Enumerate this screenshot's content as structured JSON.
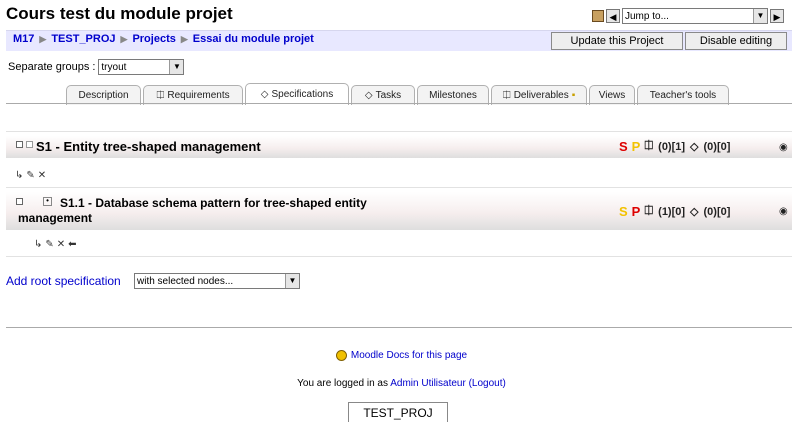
{
  "header": {
    "title": "Cours test du module projet",
    "jump_to": "Jump to..."
  },
  "breadcrumb": [
    "M17",
    "TEST_PROJ",
    "Projects",
    "Essai du module projet"
  ],
  "buttons": {
    "update": "Update this Project",
    "disable": "Disable editing"
  },
  "groups": {
    "label": "Separate groups",
    "value": "tryout"
  },
  "tabs": [
    {
      "label": "Description",
      "icon": ""
    },
    {
      "label": "Requirements",
      "icon": "requirement-icon"
    },
    {
      "label": "Specifications",
      "icon": "diamond-icon",
      "active": true
    },
    {
      "label": "Tasks",
      "icon": "diamond-icon"
    },
    {
      "label": "Milestones",
      "icon": ""
    },
    {
      "label": "Deliverables",
      "icon": "deliverable-icon"
    },
    {
      "label": "Views",
      "icon": ""
    },
    {
      "label": "Teacher's tools",
      "icon": ""
    }
  ],
  "specs": [
    {
      "title": "S1 - Entity tree-shaped management",
      "s": "S",
      "p": "P",
      "req_count": "(0)[1]",
      "task_count": "(0)[0]"
    },
    {
      "title_line1": "S1.1 - Database schema pattern for tree-shaped entity",
      "title_line2": "management",
      "s": "S",
      "p": "P",
      "req_count": "(1)[0]",
      "task_count": "(0)[0]"
    }
  ],
  "actions": {
    "add_root": "Add root specification",
    "with_selected": "with selected nodes..."
  },
  "footer": {
    "docs": "Moodle Docs for this page",
    "logged_prefix": "You are logged in as",
    "user": "Admin Utilisateur",
    "logout": "(Logout)",
    "course": "TEST_PROJ"
  },
  "colors": {
    "navbar": "#e8e8ff",
    "link": "#0000cc",
    "s_red": "#dd0000",
    "p_yellow": "#f2c200"
  }
}
